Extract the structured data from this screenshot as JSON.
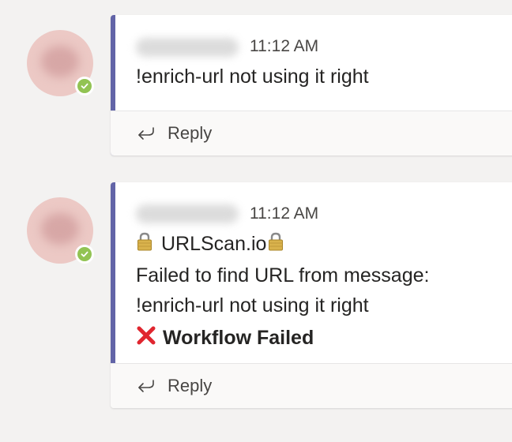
{
  "messages": [
    {
      "timestamp": "11:12 AM",
      "lines": [
        "!enrich-url not using it right"
      ],
      "reply_label": "Reply"
    },
    {
      "timestamp": "11:12 AM",
      "title": "URLScan.io",
      "lines": [
        "Failed to find URL from message:",
        "!enrich-url not using it right"
      ],
      "status": "Workflow Failed",
      "reply_label": "Reply"
    }
  ],
  "colors": {
    "accent": "#6264a7",
    "presence_available": "#92c353",
    "error": "#e0262f"
  },
  "icons": {
    "presence": "check-icon",
    "title_prefix": "lock-icon",
    "title_suffix": "lock-icon",
    "status": "cross-mark-icon",
    "reply": "reply-arrow-icon"
  }
}
